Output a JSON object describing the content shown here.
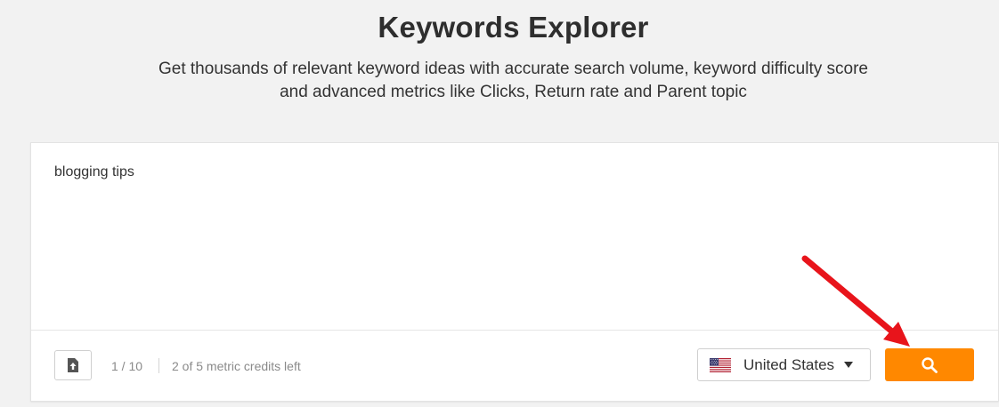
{
  "header": {
    "title": "Keywords Explorer",
    "subtitle_line1": "Get thousands of relevant keyword ideas with accurate search volume, keyword difficulty score",
    "subtitle_line2": "and advanced metrics like Clicks, Return rate and Parent topic"
  },
  "search_box": {
    "query": "blogging tips",
    "counter": "1 / 10",
    "credits": "2 of 5 metric credits left",
    "country": "United States",
    "country_icon": "us-flag-icon",
    "upload_icon": "file-upload-icon",
    "search_icon": "magnifier-icon"
  },
  "colors": {
    "accent": "#ff8800",
    "background": "#f2f2f2",
    "annotation_arrow": "#e8141b"
  }
}
